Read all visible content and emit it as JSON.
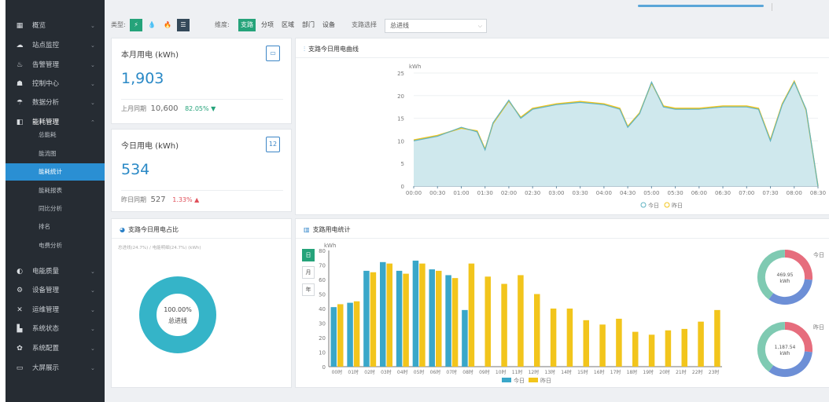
{
  "sidebar": {
    "items": [
      {
        "icon": "grid-icon",
        "glyph": "▦",
        "label": "概览"
      },
      {
        "icon": "monitor-icon",
        "glyph": "☁",
        "label": "站点监控"
      },
      {
        "icon": "alarm-icon",
        "glyph": "♨",
        "label": "告警管理"
      },
      {
        "icon": "control-icon",
        "glyph": "☗",
        "label": "控制中心"
      },
      {
        "icon": "analysis-icon",
        "glyph": "☂",
        "label": "数据分析"
      },
      {
        "icon": "energy-icon",
        "glyph": "◧",
        "label": "能耗管理"
      },
      {
        "icon": "quality-icon",
        "glyph": "◐",
        "label": "电能质量"
      },
      {
        "icon": "device-icon",
        "glyph": "⚙",
        "label": "设备管理"
      },
      {
        "icon": "ops-icon",
        "glyph": "✕",
        "label": "运维管理"
      },
      {
        "icon": "system-status-icon",
        "glyph": "▙",
        "label": "系统状态"
      },
      {
        "icon": "settings-icon",
        "glyph": "✿",
        "label": "系统配置"
      },
      {
        "icon": "screen-icon",
        "glyph": "▭",
        "label": "大屏展示"
      }
    ],
    "subitems": [
      "总能耗",
      "能流图",
      "能耗统计",
      "能耗报表",
      "同比分析",
      "排名",
      "电费分析"
    ]
  },
  "toolbar": {
    "type_label": "类型:",
    "type_buttons": [
      "⚡",
      "💧",
      "🔥",
      "☰"
    ],
    "dim_label": "维度:",
    "dim_buttons": [
      "支路",
      "分项",
      "区域",
      "部门",
      "设备"
    ],
    "select_label": "支路选择",
    "select_value": "总进线"
  },
  "kpi_month": {
    "title": "本月用电 (kWh)",
    "value": "1,903",
    "prev_label": "上月同期",
    "prev_value": "10,600",
    "change": "82.05% ▼",
    "change_color": "#25a37a",
    "icon": "calendar-month-icon"
  },
  "kpi_today": {
    "title": "今日用电 (kWh)",
    "value": "534",
    "prev_label": "昨日同期",
    "prev_value": "527",
    "change": "1.33% ▲",
    "change_color": "#e0505a",
    "icon_text": "12",
    "icon": "calendar-day-icon"
  },
  "line_chart": {
    "title": "支路今日用电曲线",
    "unit": "kWh",
    "legend": [
      "今日",
      "昨日"
    ]
  },
  "donut_card": {
    "title": "支路今日用电占比",
    "subtitle": "总进线(24.7%) / 电能明细(24.7%) (kWh)",
    "center_pct": "100.00%",
    "center_name": "总进线",
    "color": "#35b4c8"
  },
  "bar_chart": {
    "title": "支路用电统计",
    "unit": "kWh",
    "toggles": [
      "日",
      "月",
      "年"
    ],
    "legend": [
      "今日",
      "昨日"
    ]
  },
  "mini_donuts": [
    {
      "label": "今日",
      "center": "469.95\nkWh"
    },
    {
      "label": "昨日",
      "center": "1,187.54\nkWh"
    }
  ],
  "colors": {
    "today": "#3aa7c9",
    "yesterday": "#f2c51c",
    "accent": "#25a37a",
    "sidebar": "#262c33",
    "active": "#2a8fd3"
  },
  "chart_data": [
    {
      "type": "area",
      "ylim": [
        0,
        25
      ],
      "yticks": [
        0,
        5,
        10,
        15,
        20,
        25
      ],
      "xticks": [
        "00:00",
        "00:30",
        "01:00",
        "01:30",
        "02:00",
        "02:30",
        "03:00",
        "03:30",
        "04:00",
        "04:30",
        "05:00",
        "05:30",
        "06:00",
        "06:30",
        "07:00",
        "07:30",
        "08:00",
        "08:30"
      ],
      "x": [
        "00:00",
        "00:30",
        "01:00",
        "01:20",
        "01:30",
        "01:40",
        "02:00",
        "02:15",
        "02:30",
        "03:00",
        "03:30",
        "04:00",
        "04:20",
        "04:30",
        "04:45",
        "05:00",
        "05:15",
        "05:30",
        "06:00",
        "06:30",
        "07:00",
        "07:15",
        "07:30",
        "07:45",
        "08:00",
        "08:15",
        "08:30"
      ],
      "series": [
        {
          "name": "今日",
          "values": [
            10,
            11,
            13,
            12,
            8,
            14,
            19,
            15,
            17,
            18,
            18.5,
            18,
            17,
            13,
            16,
            23,
            17.5,
            17,
            17,
            17.5,
            17.5,
            17,
            10,
            18,
            23,
            17,
            0
          ]
        },
        {
          "name": "昨日",
          "values": [
            10.2,
            11.2,
            12.8,
            12.2,
            8.2,
            13.8,
            18.8,
            15.2,
            17.2,
            18.2,
            18.7,
            18.2,
            17.2,
            13.2,
            16.2,
            22.8,
            17.7,
            17.2,
            17.2,
            17.7,
            17.7,
            17.2,
            10.2,
            18.2,
            23.2,
            16.8,
            0
          ]
        }
      ]
    },
    {
      "type": "bar",
      "ylim": [
        0,
        80
      ],
      "yticks": [
        0,
        10,
        20,
        30,
        40,
        50,
        60,
        70,
        80
      ],
      "categories": [
        "00时",
        "01时",
        "02时",
        "03时",
        "04时",
        "05时",
        "06时",
        "07时",
        "08时",
        "09时",
        "10时",
        "11时",
        "12时",
        "13时",
        "14时",
        "15时",
        "16时",
        "17时",
        "18时",
        "19时",
        "20时",
        "21时",
        "22时",
        "23时"
      ],
      "series": [
        {
          "name": "今日",
          "values": [
            41,
            44,
            66,
            72,
            66,
            73,
            67,
            63,
            39,
            null,
            null,
            null,
            null,
            null,
            null,
            null,
            null,
            null,
            null,
            null,
            null,
            null,
            null,
            null
          ]
        },
        {
          "name": "昨日",
          "values": [
            43,
            45,
            65,
            71,
            64,
            71,
            66,
            61,
            71,
            62,
            57,
            63,
            50,
            40,
            40,
            32,
            29,
            33,
            24,
            22,
            25,
            26,
            31,
            39
          ]
        }
      ]
    },
    {
      "type": "pie",
      "labels": [
        "总进线"
      ],
      "values": [
        100
      ]
    },
    {
      "type": "pie",
      "labels": [
        "今日"
      ],
      "values": [
        469.95
      ]
    },
    {
      "type": "pie",
      "labels": [
        "昨日"
      ],
      "values": [
        1187.54
      ]
    }
  ]
}
